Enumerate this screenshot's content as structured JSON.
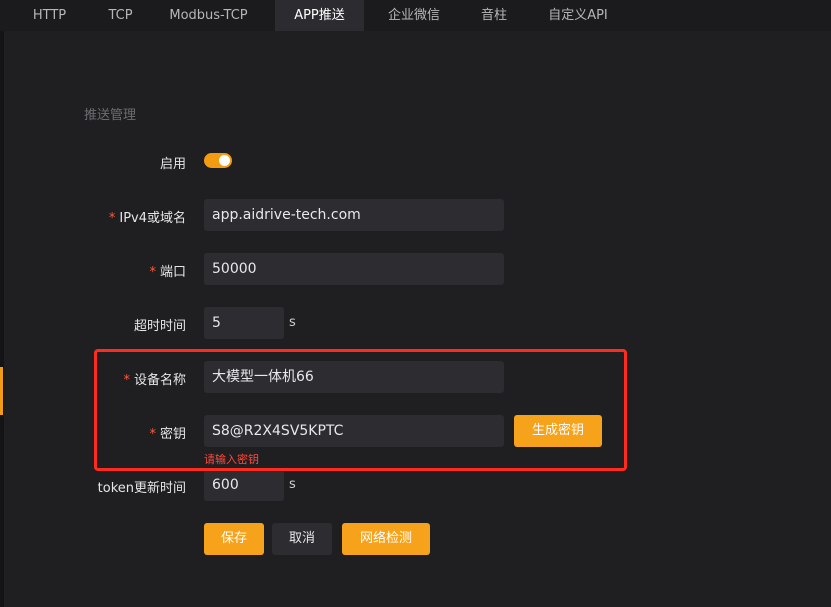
{
  "tabs": [
    {
      "label": "HTTP"
    },
    {
      "label": "TCP"
    },
    {
      "label": "Modbus-TCP"
    },
    {
      "label": "APP推送"
    },
    {
      "label": "企业微信"
    },
    {
      "label": "音柱"
    },
    {
      "label": "自定义API"
    }
  ],
  "section_title": "推送管理",
  "form": {
    "enable_label": "启用",
    "enable_value": true,
    "host_label": "IPv4或域名",
    "host_value": "app.aidrive-tech.com",
    "port_label": "端口",
    "port_value": "50000",
    "timeout_label": "超时时间",
    "timeout_value": "5",
    "timeout_unit": "s",
    "device_label": "设备名称",
    "device_value": "大模型一体机66",
    "secret_label": "密钥",
    "secret_value": "S8@R2X4SV5KPTC",
    "secret_error": "请输入密钥",
    "generate_label": "生成密钥",
    "token_label": "token更新时间",
    "token_value": "600",
    "token_unit": "s",
    "required_mark": "*"
  },
  "actions": {
    "save_label": "保存",
    "cancel_label": "取消",
    "network_check_label": "网络检测"
  },
  "colors": {
    "accent": "#f7a21b",
    "error": "#ff4a3d",
    "highlight": "#ff2a20"
  }
}
